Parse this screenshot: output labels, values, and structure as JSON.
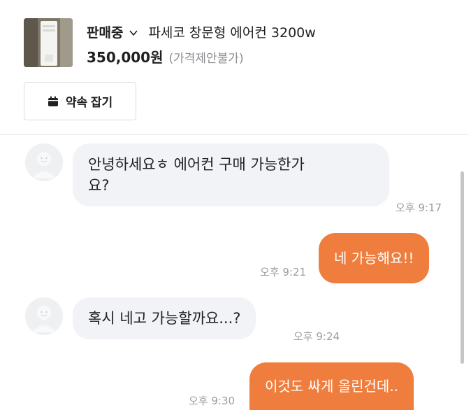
{
  "product": {
    "status": "판매중",
    "title": "파세코 창문형 에어컨 3200w",
    "price": "350,000원",
    "negotiation": "(가격제안불가)",
    "thumbnail_icon": "air-conditioner-photo"
  },
  "actions": {
    "appointment_label": "약속 잡기",
    "appointment_icon": "calendar-icon"
  },
  "messages": [
    {
      "direction": "in",
      "lines": [
        "안녕하세요ㅎ 에어컨 구매 가능한가",
        "요?"
      ],
      "time": "오후 9:17"
    },
    {
      "direction": "out",
      "text": "네 가능해요!!",
      "time": "오후 9:21"
    },
    {
      "direction": "in",
      "lines": [
        "혹시 네고 가능할까요...?"
      ],
      "time": "오후 9:24"
    },
    {
      "direction": "out",
      "text": "이것도 싸게 올린건데..",
      "time": "오후 9:30"
    }
  ],
  "colors": {
    "accent": "#ef7d3d",
    "incoming_bubble": "#f2f3f6",
    "muted_text": "#9a9ca1"
  }
}
